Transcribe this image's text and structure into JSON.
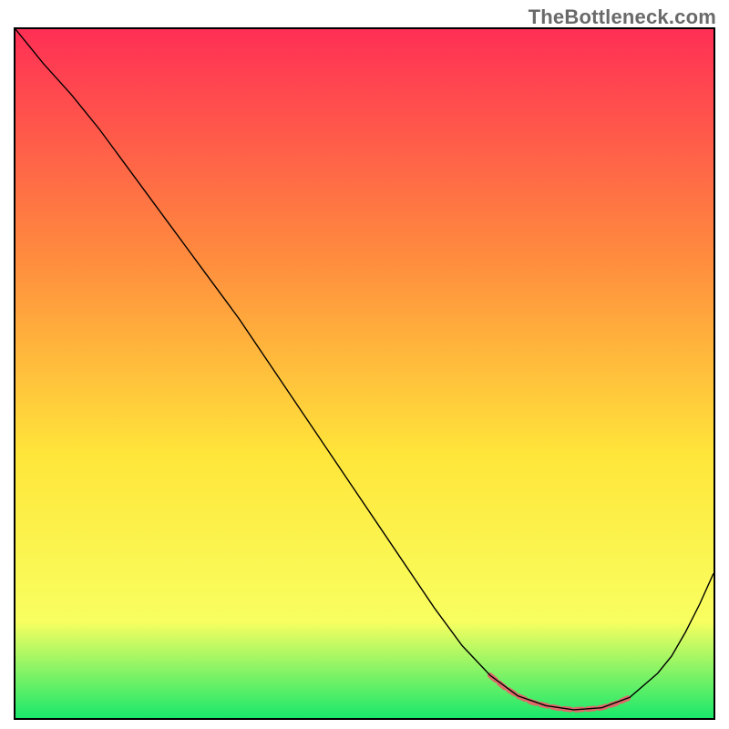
{
  "watermark": "TheBottleneck.com",
  "chart_data": {
    "type": "line",
    "title": "",
    "xlabel": "",
    "ylabel": "",
    "xlim": [
      0,
      100
    ],
    "ylim": [
      0,
      100
    ],
    "grid": false,
    "legend": false,
    "background_gradient": {
      "top": "#ff2f55",
      "upper_mid": "#ff8b3e",
      "mid": "#ffe63a",
      "lower_mid": "#f8ff60",
      "bottom": "#19e86b"
    },
    "series": [
      {
        "name": "curve",
        "stroke": "#000000",
        "stroke_width": 1.4,
        "x": [
          0,
          4,
          8,
          12,
          16,
          20,
          24,
          28,
          32,
          36,
          40,
          44,
          48,
          52,
          56,
          60,
          64,
          68,
          72,
          76,
          80,
          84,
          88,
          92,
          94,
          96,
          98,
          100
        ],
        "y": [
          100,
          95,
          90.5,
          85.5,
          80,
          74.5,
          69,
          63.5,
          58,
          52,
          46,
          40,
          34,
          28,
          22,
          16,
          10.5,
          6.2,
          3.2,
          1.8,
          1.2,
          1.5,
          3.0,
          6.5,
          9.0,
          12.5,
          16.5,
          21
        ]
      },
      {
        "name": "highlight-band",
        "stroke": "#e06a6a",
        "stroke_width": 6,
        "dasharray": "8 5",
        "x": [
          68,
          70,
          72,
          74,
          76,
          78,
          80,
          82,
          84,
          86,
          88
        ],
        "y": [
          6.2,
          4.5,
          3.2,
          2.3,
          1.8,
          1.4,
          1.2,
          1.3,
          1.5,
          2.1,
          3.0
        ]
      }
    ]
  }
}
